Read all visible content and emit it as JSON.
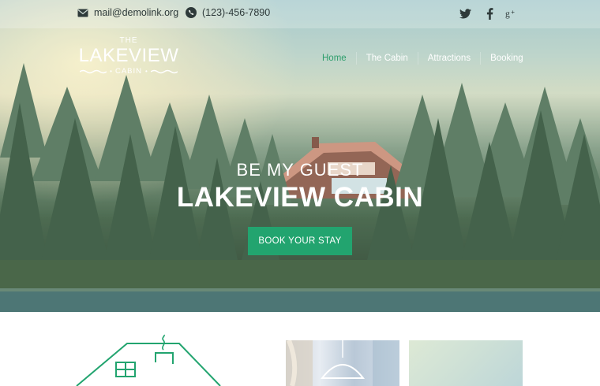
{
  "topbar": {
    "email": "mail@demolink.org",
    "phone": "(123)-456-7890",
    "social": [
      {
        "icon": "twitter-icon"
      },
      {
        "icon": "facebook-icon"
      },
      {
        "icon": "google-plus-icon"
      }
    ]
  },
  "logo": {
    "the": "THE",
    "name": "LAKEVIEW",
    "sub": "CABIN"
  },
  "nav": {
    "items": [
      {
        "label": "Home",
        "active": true
      },
      {
        "label": "The Cabin",
        "active": false
      },
      {
        "label": "Attractions",
        "active": false
      },
      {
        "label": "Booking",
        "active": false
      }
    ]
  },
  "hero": {
    "eyebrow": "BE MY GUEST",
    "title": "LAKEVIEW CABIN",
    "button": "BOOK YOUR STAY"
  },
  "colors": {
    "accent": "#22a46f",
    "nav_active": "#2f9e6d",
    "text_dark": "#2e3a3a"
  }
}
